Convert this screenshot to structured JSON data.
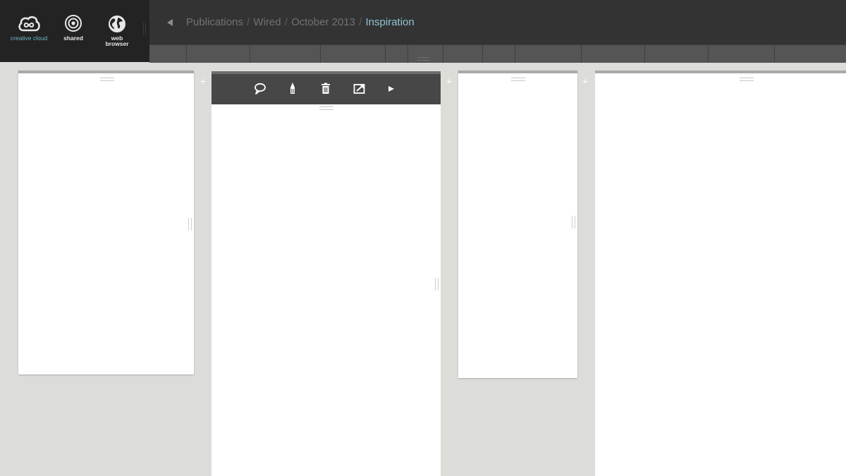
{
  "launcher": {
    "apps": [
      {
        "name": "creative-cloud",
        "label": "creative cloud",
        "icon": "creative-cloud-icon"
      },
      {
        "name": "shared",
        "label": "shared",
        "icon": "shared-icon"
      },
      {
        "name": "web-browser",
        "label": "web browser",
        "icon": "globe-icon"
      }
    ]
  },
  "nav": {
    "back_icon": "back-arrow-icon",
    "breadcrumb": [
      "Publications",
      "Wired",
      "October 2013"
    ],
    "separator": "/",
    "current": "Inspiration"
  },
  "toolbar": {
    "tools": [
      "comment-icon",
      "pen-icon",
      "trash-icon",
      "share-icon",
      "play-icon"
    ]
  },
  "add_label": "+",
  "colors": {
    "topbar": "#333333",
    "launcher": "#232323",
    "accent": "#8fc3d2",
    "workspace": "#dcdcd8",
    "toolbar": "#474747"
  }
}
